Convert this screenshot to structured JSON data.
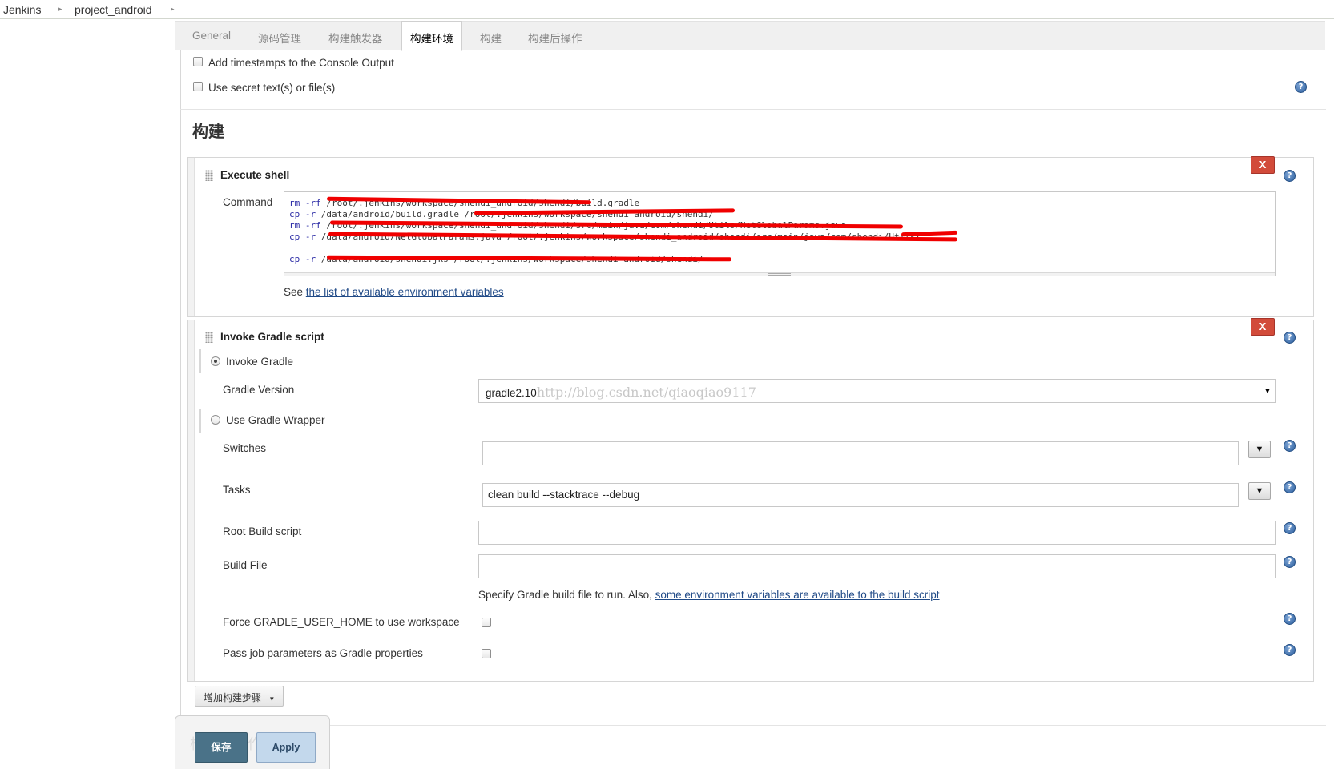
{
  "breadcrumb": {
    "root": "Jenkins",
    "project": "project_android"
  },
  "tabs": [
    {
      "label": "General"
    },
    {
      "label": "源码管理"
    },
    {
      "label": "构建触发器"
    },
    {
      "label": "构建环境"
    },
    {
      "label": "构建"
    },
    {
      "label": "构建后操作"
    }
  ],
  "active_tab": "构建环境",
  "build_env": {
    "timestamps_label": "Add timestamps to the Console Output",
    "timestamps_checked": false,
    "secret_label": "Use secret text(s) or file(s)",
    "secret_checked": false
  },
  "build_section": {
    "title": "构建"
  },
  "execute_shell": {
    "title": "Execute shell",
    "delete_label": "X",
    "command_label": "Command",
    "lines": [
      {
        "cmd": "rm -rf",
        "args": "/root/.jenkins/workspace/shendi_android/shendi/build.gradle"
      },
      {
        "cmd": "cp -r",
        "args": "/data/android/build.gradle /root/.jenkins/workspace/shendi_android/shendi/"
      },
      {
        "cmd": "rm -rf",
        "args": "/root/.jenkins/workspace/shendi_android/shendi/src/main/java/com/shendi/Utils/NetGlobalParams.java"
      },
      {
        "cmd": "cp -r",
        "args": "/data/android/NetGlobalParams.java /root/.jenkins/workspace/shendi_android/shendi/src/main/java/com/shendi/Utils/"
      },
      {
        "cmd": "",
        "args": ""
      },
      {
        "cmd": "cp -r",
        "args": "/data/android/shendi.jks /root/.jenkins/workspace/shendi_android/shendi/"
      }
    ],
    "see_prefix": "See ",
    "env_link": "the list of available environment variables"
  },
  "gradle": {
    "title": "Invoke Gradle script",
    "delete_label": "X",
    "invoke_gradle_label": "Invoke Gradle",
    "invoke_gradle_selected": true,
    "gradle_version_label": "Gradle Version",
    "gradle_version_value": "gradle2.10",
    "watermark": "http://blog.csdn.net/qiaoqiao9117",
    "wrapper_label": "Use Gradle Wrapper",
    "wrapper_selected": false,
    "switches_label": "Switches",
    "switches_value": "",
    "tasks_label": "Tasks",
    "tasks_value": "clean build --stacktrace --debug",
    "root_build_label": "Root Build script",
    "root_build_value": "",
    "build_file_label": "Build File",
    "build_file_value": "",
    "build_file_hint": "Specify Gradle build file to run. Also, ",
    "build_file_link": "some environment variables are available to the build script",
    "force_home_label": "Force GRADLE_USER_HOME to use workspace",
    "force_home_checked": false,
    "pass_params_label": "Pass job parameters as Gradle properties",
    "pass_params_checked": false,
    "expand_glyph": "▼"
  },
  "add_step_label": "增加构建步骤",
  "save_label": "保存",
  "apply_label": "Apply",
  "ghost_text": "构建后操作",
  "icons": {
    "help": "question-circle",
    "delete": "x-button",
    "grip": "drag-handle",
    "dropdown": "caret-down"
  },
  "colors": {
    "delete_red": "#d24b3a",
    "save_teal": "#4a7288",
    "apply_blue": "#c3d8ec",
    "link_blue": "#204a87",
    "redaction_red": "#f00000"
  }
}
